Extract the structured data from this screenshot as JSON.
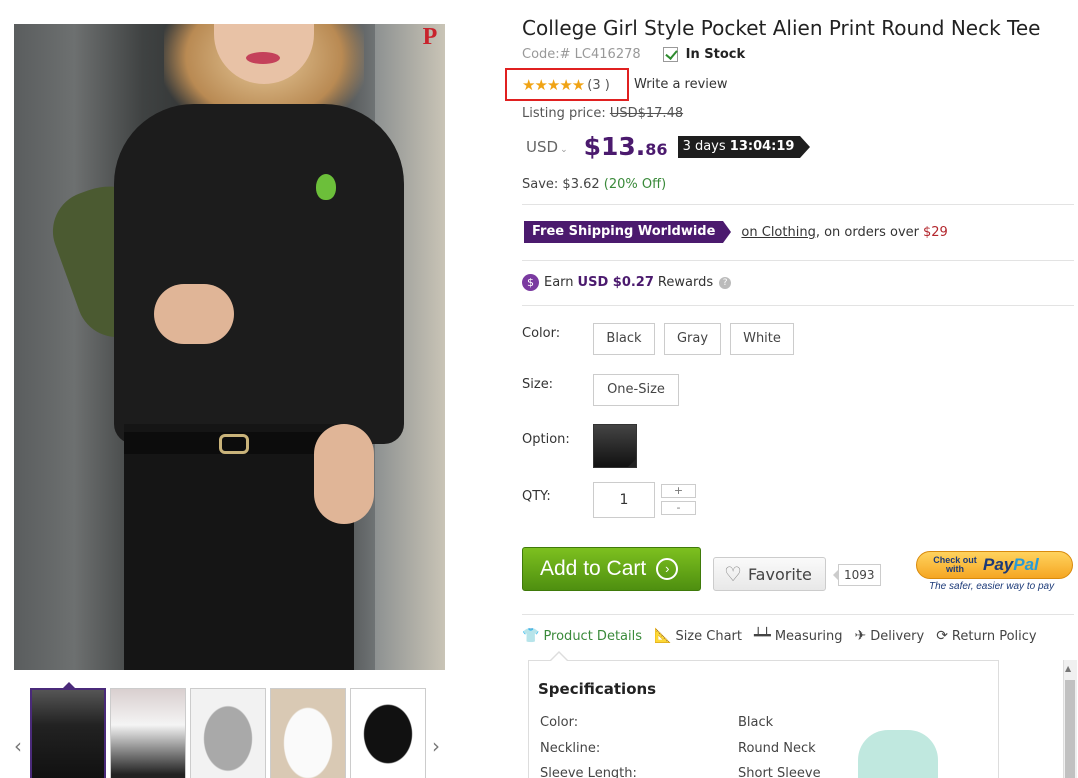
{
  "product": {
    "title": "College Girl Style Pocket Alien Print Round Neck Tee",
    "code": "Code:# LC416278",
    "stock": "In Stock",
    "stars": "★★★★★",
    "rating_count": "(3 )",
    "write_review": "Write a review",
    "listing_label": "Listing price:",
    "listing_price": "USD$17.48",
    "currency": "USD",
    "price_main": "$13.",
    "price_cents": "86",
    "timer_days": "3 days",
    "timer_time": "13:04:19",
    "save_label": "Save: $3.62",
    "save_pct": "(20% Off)"
  },
  "shipping": {
    "badge": "Free Shipping Worldwide",
    "link": "on Clothing",
    "text": ", on orders over",
    "amount": "$29"
  },
  "rewards": {
    "earn": "Earn",
    "amount": "USD $0.27",
    "label": "Rewards"
  },
  "options": {
    "color_label": "Color:",
    "colors": [
      "Black",
      "Gray",
      "White"
    ],
    "size_label": "Size:",
    "sizes": [
      "One-Size"
    ],
    "option_label": "Option:",
    "qty_label": "QTY:",
    "qty_value": "1",
    "plus": "+",
    "minus": "-"
  },
  "actions": {
    "add_to_cart": "Add to Cart",
    "favorite": "Favorite",
    "favorite_count": "1093",
    "paypal_small": "Check out with",
    "paypal_brand_a": "Pay",
    "paypal_brand_b": "Pal",
    "paypal_sub": "The safer, easier way to pay"
  },
  "tabs": [
    {
      "label": "Product Details",
      "icon": "shirt-icon"
    },
    {
      "label": "Size Chart",
      "icon": "ruler-icon"
    },
    {
      "label": "Measuring",
      "icon": "measure-icon"
    },
    {
      "label": "Delivery",
      "icon": "plane-icon"
    },
    {
      "label": "Return Policy",
      "icon": "refresh-icon"
    }
  ],
  "specs": {
    "title": "Specifications",
    "rows": [
      {
        "key": "Color:",
        "value": "Black"
      },
      {
        "key": "Neckline:",
        "value": "Round Neck"
      },
      {
        "key": "Sleeve Length:",
        "value": "Short Sleeve"
      }
    ]
  },
  "colors": {
    "accent": "#4b1a6e",
    "stars": "#f0a314",
    "green": "#3a8a3a",
    "red": "#b3262d"
  }
}
